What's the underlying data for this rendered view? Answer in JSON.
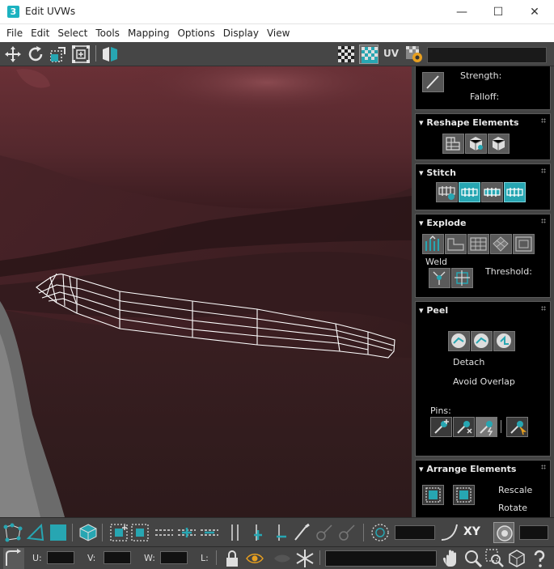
{
  "window": {
    "app_icon_text": "3",
    "title": "Edit UVWs",
    "minimize": "—",
    "maximize": "☐",
    "close": "✕"
  },
  "menu": [
    "File",
    "Edit",
    "Select",
    "Tools",
    "Mapping",
    "Options",
    "Display",
    "View"
  ],
  "toolbar": {
    "uv_label": "UV",
    "icons": [
      "move-icon",
      "rotate-icon",
      "scale-icon",
      "freeform-icon",
      "mirror-icon",
      "checker-icon",
      "checker-active-icon",
      "uv-settings-icon"
    ]
  },
  "panel": {
    "top_section": {
      "strength_label": "Strength:",
      "falloff_label": "Falloff:"
    },
    "reshape": {
      "title": "Reshape Elements"
    },
    "stitch": {
      "title": "Stitch"
    },
    "explode": {
      "title": "Explode",
      "weld_label": "Weld",
      "threshold_label": "Threshold:"
    },
    "peel": {
      "title": "Peel",
      "detach_label": "Detach",
      "avoid_overlap_label": "Avoid Overlap",
      "pins_label": "Pins:"
    },
    "arrange": {
      "title": "Arrange Elements",
      "rescale_label": "Rescale",
      "rotate_label": "Rotate"
    }
  },
  "bottom": {
    "xy_label": "XY",
    "u_label": "U:",
    "v_label": "V:",
    "w_label": "W:",
    "l_label": "L:"
  },
  "colors": {
    "accent": "#27a6b2",
    "panel_bg": "#000000",
    "ui_bg": "#444444",
    "mesh": "#ffffff"
  }
}
